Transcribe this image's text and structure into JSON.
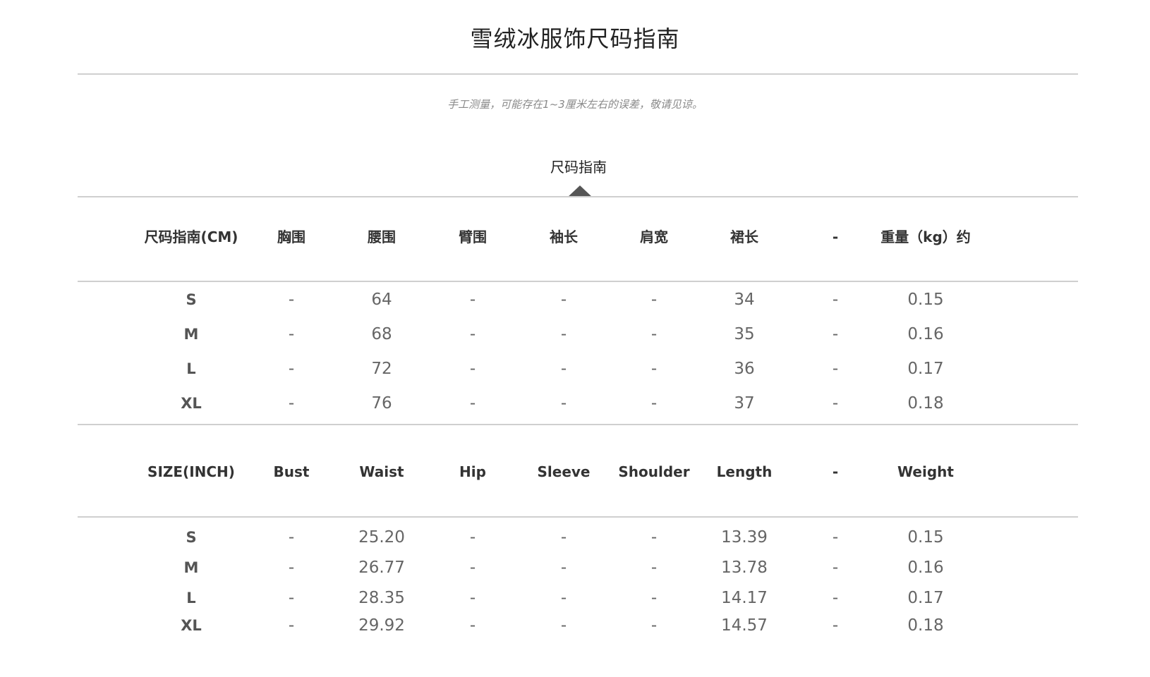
{
  "title": "雪绒冰服饰尺码指南",
  "note": "手工测量，可能存在1~3厘米左右的误差，敬请见谅。",
  "section_label": "尺码指南",
  "cm_table": {
    "headers": [
      "尺码指南(CM)",
      "胸围",
      "腰围",
      "臂围",
      "袖长",
      "肩宽",
      "裙长",
      "-",
      "重量（kg）约"
    ],
    "rows": [
      [
        "S",
        "-",
        "64",
        "-",
        "-",
        "-",
        "34",
        "-",
        "0.15"
      ],
      [
        "M",
        "-",
        "68",
        "-",
        "-",
        "-",
        "35",
        "-",
        "0.16"
      ],
      [
        "L",
        "-",
        "72",
        "-",
        "-",
        "-",
        "36",
        "-",
        "0.17"
      ],
      [
        "XL",
        "-",
        "76",
        "-",
        "-",
        "-",
        "37",
        "-",
        "0.18"
      ]
    ]
  },
  "inch_table": {
    "headers": [
      "SIZE(INCH)",
      "Bust",
      "Waist",
      "Hip",
      "Sleeve",
      "Shoulder",
      "Length",
      "-",
      "Weight"
    ],
    "rows": [
      [
        "S",
        "-",
        "25.20",
        "-",
        "-",
        "-",
        "13.39",
        "-",
        "0.15"
      ],
      [
        "M",
        "-",
        "26.77",
        "-",
        "-",
        "-",
        "13.78",
        "-",
        "0.16"
      ],
      [
        "L",
        "-",
        "28.35",
        "-",
        "-",
        "-",
        "14.17",
        "-",
        "0.17"
      ],
      [
        "XL",
        "-",
        "29.92",
        "-",
        "-",
        "-",
        "14.57",
        "-",
        "0.18"
      ]
    ]
  },
  "colors": {
    "rule": "#cfcfcf",
    "header_text": "#333333",
    "value_text": "#666666",
    "note_text": "#8a8a8a",
    "pointer": "#555555"
  }
}
